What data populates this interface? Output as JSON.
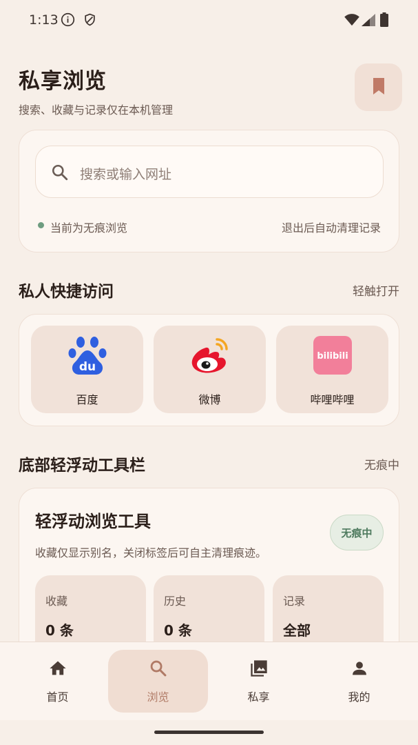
{
  "status_bar": {
    "time": "1:13"
  },
  "header": {
    "title": "私享浏览",
    "subtitle": "搜索、收藏与记录仅在本机管理"
  },
  "search": {
    "placeholder": "搜索或输入网址",
    "mode_text": "当前为无痕浏览",
    "auto_clean_text": "退出后自动清理记录"
  },
  "quick_access": {
    "title": "私人快捷访问",
    "action": "轻触打开",
    "items": [
      {
        "label": "百度",
        "icon": "baidu-logo-icon"
      },
      {
        "label": "微博",
        "icon": "weibo-logo-icon"
      },
      {
        "label": "哔哩哔哩",
        "icon": "bilibili-logo-icon"
      }
    ]
  },
  "toolbar_section": {
    "title": "底部轻浮动工具栏",
    "status": "无痕中"
  },
  "tools_card": {
    "title": "轻浮动浏览工具",
    "subtitle": "收藏仅显示别名，关闭标签后可自主清理痕迹。",
    "badge": "无痕中",
    "stats": [
      {
        "label": "收藏",
        "value": "0 条"
      },
      {
        "label": "历史",
        "value": "0 条"
      },
      {
        "label": "记录",
        "value": "全部"
      }
    ]
  },
  "bottom_nav": {
    "items": [
      {
        "label": "首页",
        "icon": "home-icon"
      },
      {
        "label": "浏览",
        "icon": "search-icon",
        "active": true
      },
      {
        "label": "私享",
        "icon": "gallery-icon"
      },
      {
        "label": "我的",
        "icon": "person-icon"
      }
    ]
  },
  "colors": {
    "background": "#f7efe8",
    "accent": "#b07a66",
    "incognito_green": "#4e7a5e",
    "bilibili_pink": "#f27f9a",
    "baidu_blue": "#2f5fe0",
    "weibo_red": "#e6162d"
  },
  "bilibili_logo_text": "bilibili"
}
